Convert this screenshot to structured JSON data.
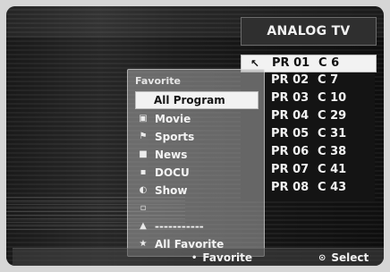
{
  "header": {
    "title": "ANALOG TV"
  },
  "channels": [
    {
      "pr": "PR 01",
      "ch": "C 6",
      "indicator": "↖"
    },
    {
      "pr": "PR 02",
      "ch": "C 7",
      "indicator": ""
    },
    {
      "pr": "PR 03",
      "ch": "C 10",
      "indicator": ""
    },
    {
      "pr": "PR 04",
      "ch": "C 29",
      "indicator": ""
    },
    {
      "pr": "PR 05",
      "ch": "C 31",
      "indicator": ""
    },
    {
      "pr": "PR 06",
      "ch": "C 38",
      "indicator": ""
    },
    {
      "pr": "PR 07",
      "ch": "C 41",
      "indicator": ""
    },
    {
      "pr": "PR 08",
      "ch": "C 43",
      "indicator": ""
    }
  ],
  "favorite_popup": {
    "title": "Favorite",
    "items": [
      {
        "label": "All Program",
        "icon": ""
      },
      {
        "label": "Movie",
        "icon": "film-icon"
      },
      {
        "label": "Sports",
        "icon": "sports-icon"
      },
      {
        "label": "News",
        "icon": "news-icon"
      },
      {
        "label": "DOCU",
        "icon": "docu-icon"
      },
      {
        "label": "Show",
        "icon": "show-icon"
      },
      {
        "label": "",
        "icon": "blank-icon"
      },
      {
        "label": "-----------",
        "icon": "person-icon"
      },
      {
        "label": "All Favorite",
        "icon": "star-icon"
      }
    ]
  },
  "footer": {
    "favorite_label": "Favorite",
    "select_label": "Select"
  },
  "colors": {
    "accent_white": "#f2f2f2",
    "panel_dark": "#141414"
  }
}
